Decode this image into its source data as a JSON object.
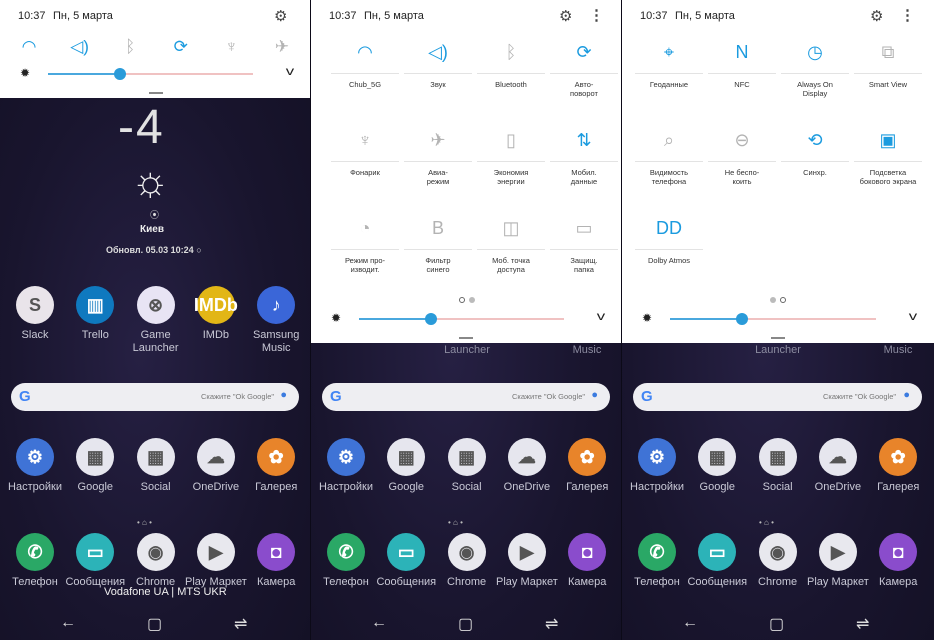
{
  "status": {
    "time": "10:37",
    "date": "Пн, 5 марта"
  },
  "colors": {
    "accent": "#1b9bdf",
    "inactive": "#b3b3b3",
    "shade_bg": "#ffffff",
    "home_bg": "#1c1732"
  },
  "quick_bar": [
    {
      "icon": "wifi-icon",
      "state": "on"
    },
    {
      "icon": "volume-icon",
      "state": "on"
    },
    {
      "icon": "bluetooth-icon",
      "state": "off"
    },
    {
      "icon": "auto-rotate-icon",
      "state": "on"
    },
    {
      "icon": "flashlight-icon",
      "state": "off"
    },
    {
      "icon": "airplane-icon",
      "state": "off"
    }
  ],
  "brightness": {
    "level": 0.35
  },
  "panel2_tiles": [
    {
      "label": "Chub_5G",
      "icon": "wifi-icon",
      "state": "on"
    },
    {
      "label": "Звук",
      "icon": "volume-icon",
      "state": "on"
    },
    {
      "label": "Bluetooth",
      "icon": "bluetooth-icon",
      "state": "off"
    },
    {
      "label": "Авто-\nповорот",
      "icon": "auto-rotate-icon",
      "state": "on"
    },
    {
      "label": "Фонарик",
      "icon": "flashlight-icon",
      "state": "off"
    },
    {
      "label": "Авиа-\nрежим",
      "icon": "airplane-icon",
      "state": "off"
    },
    {
      "label": "Экономия\nэнергии",
      "icon": "battery-icon",
      "state": "off"
    },
    {
      "label": "Мобил.\nданные",
      "icon": "mobile-data-icon",
      "state": "on"
    },
    {
      "label": "Режим про-\nизводит.",
      "icon": "performance-icon",
      "state": "off"
    },
    {
      "label": "Фильтр\nсинего",
      "icon": "blue-filter-icon",
      "state": "off"
    },
    {
      "label": "Моб. точка\nдоступа",
      "icon": "hotspot-icon",
      "state": "off"
    },
    {
      "label": "Защищ.\nпапка",
      "icon": "secure-folder-icon",
      "state": "off"
    }
  ],
  "panel3_tiles": [
    {
      "label": "Геоданные",
      "icon": "location-icon",
      "state": "on"
    },
    {
      "label": "NFC",
      "icon": "nfc-icon",
      "state": "on"
    },
    {
      "label": "Always On\nDisplay",
      "icon": "always-on-display-icon",
      "state": "on"
    },
    {
      "label": "Smart View",
      "icon": "smart-view-icon",
      "state": "off"
    },
    {
      "label": "Видимость\nтелефона",
      "icon": "phone-visibility-icon",
      "state": "off"
    },
    {
      "label": "Не беспо-\nкоить",
      "icon": "do-not-disturb-icon",
      "state": "off"
    },
    {
      "label": "Синхр.",
      "icon": "sync-icon",
      "state": "on"
    },
    {
      "label": "Подсветка\nбокового экрана",
      "icon": "edge-lighting-icon",
      "state": "on"
    },
    {
      "label": "Dolby Atmos",
      "icon": "dolby-atmos-icon",
      "state": "on"
    }
  ],
  "home": {
    "clock": "-4",
    "city": "Киев",
    "updated": "Обновл. 05.03 10:24",
    "search_placeholder": "Скажите \"Ok Google\"",
    "carrier": "Vodafone UA | MTS UKR",
    "row1": [
      {
        "name": "Slack",
        "icon": "slack-icon",
        "color": "#e9e4ea"
      },
      {
        "name": "Trello",
        "icon": "trello-icon",
        "color": "#0f79bf"
      },
      {
        "name": "Game\nLauncher",
        "icon": "game-launcher-icon",
        "color": "#e8e4f4"
      },
      {
        "name": "IMDb",
        "icon": "imdb-icon",
        "color": "#e2b616"
      },
      {
        "name": "Samsung\nMusic",
        "icon": "samsung-music-icon",
        "color": "#3a66d8"
      }
    ],
    "row2": [
      {
        "name": "Настройки",
        "icon": "settings-icon",
        "color": "#3f73d6"
      },
      {
        "name": "Google",
        "icon": "google-folder-icon",
        "color": "#e6e6ee"
      },
      {
        "name": "Social",
        "icon": "social-folder-icon",
        "color": "#e6e6ee"
      },
      {
        "name": "OneDrive",
        "icon": "onedrive-icon",
        "color": "#e6e6ee"
      },
      {
        "name": "Галерея",
        "icon": "gallery-icon",
        "color": "#e8842a"
      }
    ],
    "dock": [
      {
        "name": "Телефон",
        "icon": "phone-icon",
        "color": "#2aa866"
      },
      {
        "name": "Сообщения",
        "icon": "messages-icon",
        "color": "#2cb3b8"
      },
      {
        "name": "Chrome",
        "icon": "chrome-icon",
        "color": "#e8e8ee"
      },
      {
        "name": "Play Маркет",
        "icon": "play-store-icon",
        "color": "#e8e8ee"
      },
      {
        "name": "Камера",
        "icon": "camera-icon",
        "color": "#8a4ccc"
      }
    ]
  }
}
